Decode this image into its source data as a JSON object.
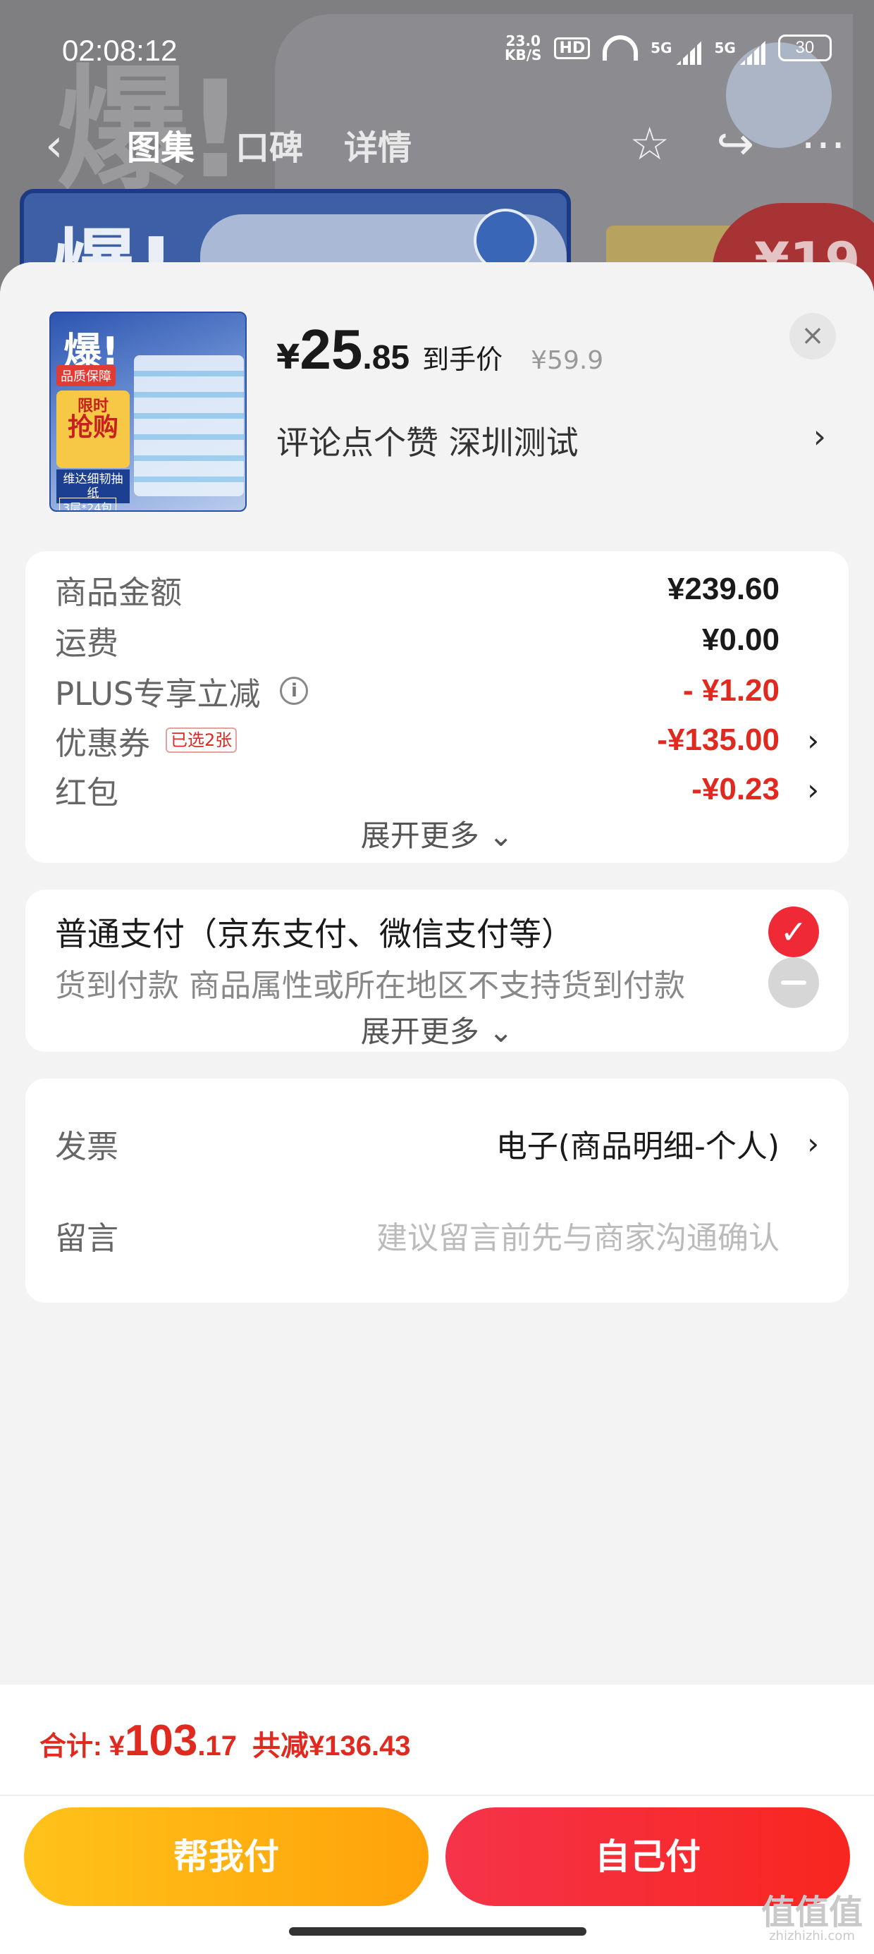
{
  "status_bar": {
    "time": "02:08:12",
    "net_speed_value": "23.0",
    "net_speed_unit": "KB/S",
    "hd_badge": "HD",
    "signal1": "5G",
    "signal2": "5G",
    "battery": "30"
  },
  "nav": {
    "tabs": [
      "图集",
      "口碑",
      "详情"
    ]
  },
  "background": {
    "banner_text": "爆!",
    "price_hint": "¥19"
  },
  "product": {
    "thumb_title": "爆!",
    "thumb_badge": "品质保障",
    "thumb_limit": "限时",
    "thumb_grab": "抢购",
    "thumb_name": "维达细韧抽纸",
    "thumb_spec": "3层*24包",
    "price_symbol": "¥",
    "price_int": "25",
    "price_dec": ".85",
    "price_tag": "到手价",
    "original_price": "¥59.9",
    "spec": "评论点个赞  深圳测试",
    "close": "×"
  },
  "summary": {
    "goods_label": "商品金额",
    "goods_value": "¥239.60",
    "shipping_label": "运费",
    "shipping_value": "¥0.00",
    "plus_label": "PLUS专享立减",
    "plus_value": "- ¥1.20",
    "coupon_label": "优惠券",
    "coupon_badge": "已选2张",
    "coupon_value": "-¥135.00",
    "redpack_label": "红包",
    "redpack_value": "-¥0.23",
    "expand": "展开更多"
  },
  "payment": {
    "normal": "普通支付（京东支付、微信支付等）",
    "cod": "货到付款 商品属性或所在地区不支持货到付款",
    "expand": "展开更多"
  },
  "invoice": {
    "invoice_label": "发票",
    "invoice_value": "电子(商品明细-个人)",
    "message_label": "留言",
    "message_placeholder": "建议留言前先与商家沟通确认"
  },
  "footer": {
    "total_label": "合计:",
    "total_symbol": "¥",
    "total_int": "103",
    "total_dec": ".17",
    "total_saved": "共减¥136.43",
    "btn_help": "帮我付",
    "btn_self": "自己付"
  },
  "watermark": {
    "text": "值值值",
    "sub": "zhizhizhi.com"
  },
  "colors": {
    "accent_red": "#e02a20",
    "pay_red": "#f5334a",
    "help_yellow": "#ffb312"
  }
}
